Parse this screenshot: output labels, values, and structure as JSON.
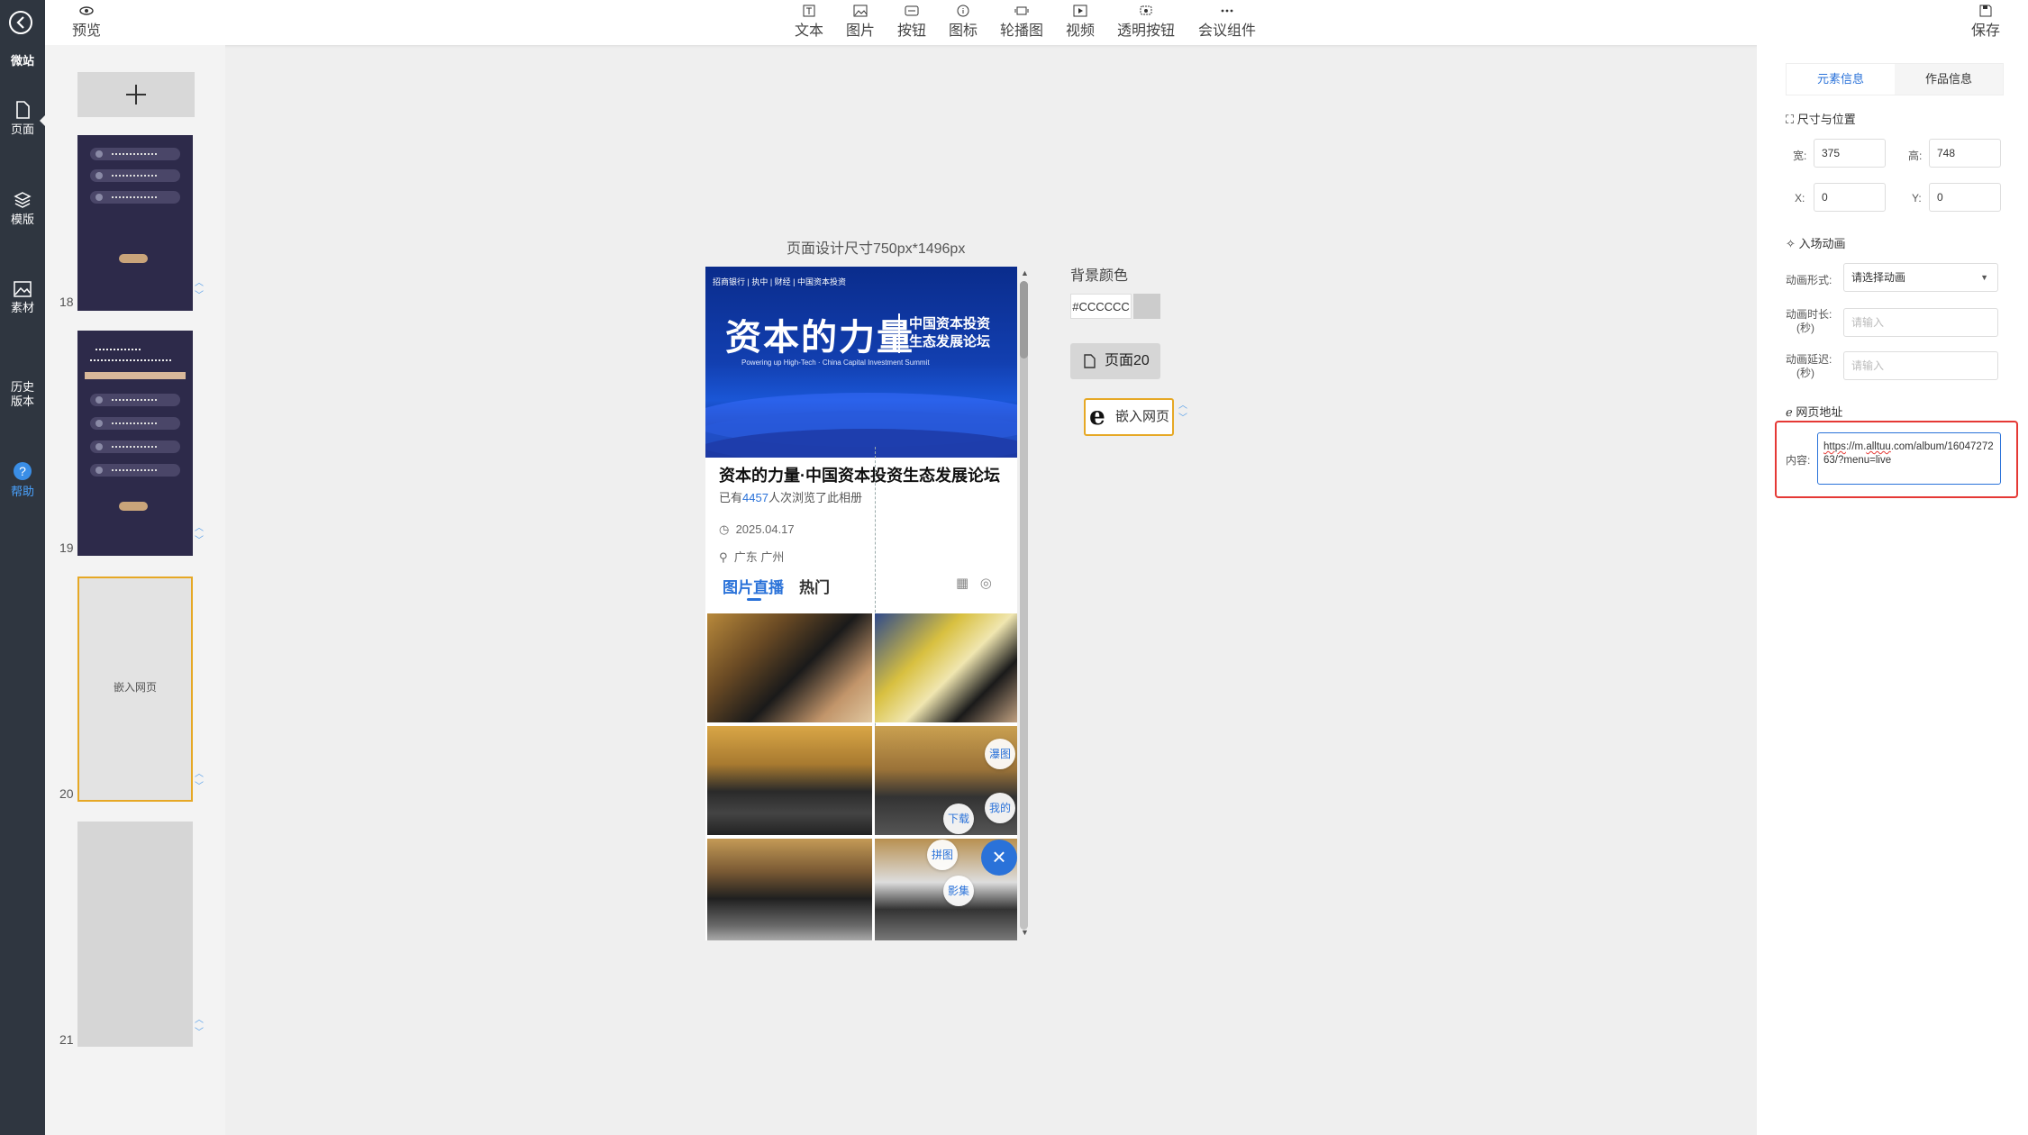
{
  "sidebar": {
    "brand": "微站",
    "items": [
      {
        "label": "页面",
        "icon": "page-icon"
      },
      {
        "label": "模版",
        "icon": "layers-icon"
      },
      {
        "label": "素材",
        "icon": "image-icon"
      },
      {
        "label": "历史版本",
        "icon": ""
      },
      {
        "label": "帮助",
        "icon": "help-icon"
      }
    ]
  },
  "toolbar": {
    "preview": "预览",
    "save": "保存",
    "tools": [
      "文本",
      "图片",
      "按钮",
      "图标",
      "轮播图",
      "视频",
      "透明按钮",
      "会议组件"
    ]
  },
  "thumbnails": {
    "pages": [
      "18",
      "19",
      "20",
      "21"
    ],
    "embed_label": "嵌入网页"
  },
  "canvas": {
    "design_size": "页面设计尺寸750px*1496px",
    "banner": {
      "logos": "招商银行 | 执中 | 财经 | 中国资本投资",
      "headline": "资本的力量",
      "subline1": "中国资本投资",
      "subline2": "生态发展论坛",
      "english": "Powering up High-Tech · China Capital Investment Summit"
    },
    "title": "资本的力量·中国资本投资生态发展论坛",
    "viewed_prefix": "已有",
    "viewed_count": "4457",
    "viewed_suffix": "人次浏览了此相册",
    "date": "2025.04.17",
    "location": "广东 广州",
    "tab_live": "图片直播",
    "tab_hot": "热门",
    "fabs": [
      "瀑图",
      "我的",
      "下载",
      "拼图",
      "影集"
    ]
  },
  "middle_panel": {
    "bg_label": "背景颜色",
    "bg_color": "#CCCCCC",
    "page_chip": "页面20",
    "embed_chip": "嵌入网页"
  },
  "properties": {
    "tab_element": "元素信息",
    "tab_work": "作品信息",
    "size_title": "尺寸与位置",
    "width_label": "宽:",
    "width": "375",
    "height_label": "高:",
    "height": "748",
    "x_label": "X:",
    "x": "0",
    "y_label": "Y:",
    "y": "0",
    "anim_title": "入场动画",
    "anim_type_label": "动画形式:",
    "anim_type": "请选择动画",
    "anim_duration_label": "动画时长:",
    "anim_duration_unit": "(秒)",
    "anim_duration_ph": "请输入",
    "anim_delay_label": "动画延迟:",
    "anim_delay_unit": "(秒)",
    "anim_delay_ph": "请输入",
    "url_title": "网页地址",
    "content_label": "内容:",
    "url_a": "https",
    "url_b": "://m.",
    "url_c": "alltuu",
    "url_d": ".com/album/1604727263/?menu=live"
  },
  "colors": {
    "accent": "#2a72d9",
    "sidebar": "#2f3640",
    "highlight": "#e53935",
    "selected_border": "#e6a825"
  }
}
